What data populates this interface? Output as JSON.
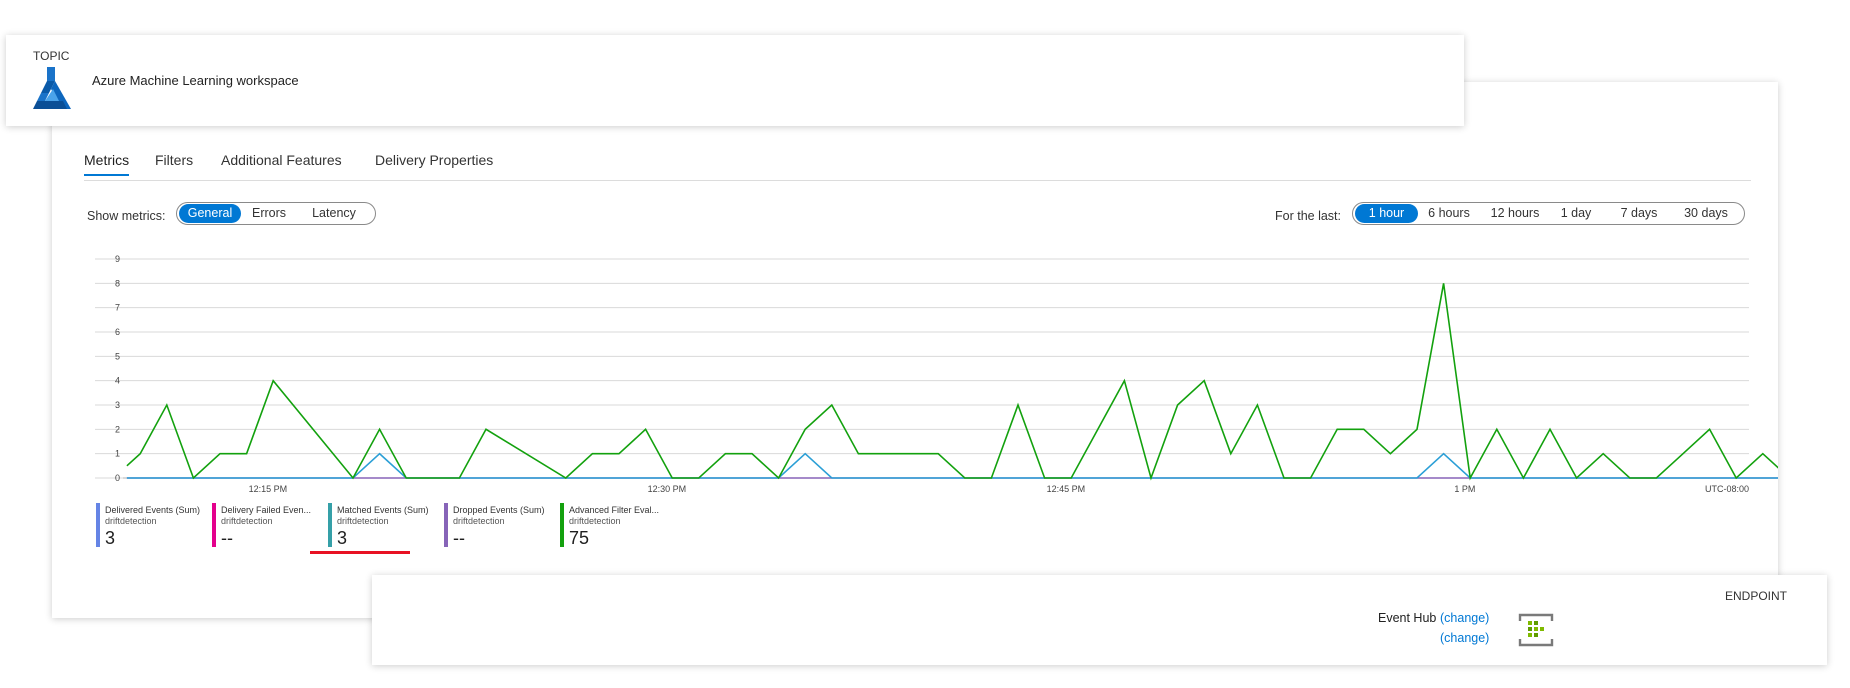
{
  "topic": {
    "caption": "TOPIC",
    "title": "Azure Machine Learning workspace",
    "icon": "azure-ml-flask-icon"
  },
  "tabs": [
    "Metrics",
    "Filters",
    "Additional Features",
    "Delivery Properties"
  ],
  "active_tab": "Metrics",
  "metrics_selector": {
    "label": "Show metrics:",
    "options": [
      "General",
      "Errors",
      "Latency"
    ],
    "selected": "General"
  },
  "time_selector": {
    "label": "For the last:",
    "options": [
      "1 hour",
      "6 hours",
      "12 hours",
      "1 day",
      "7 days",
      "30 days"
    ],
    "selected": "1 hour"
  },
  "colors": {
    "accent": "#0078d4",
    "advanced_filter": "#13a10e",
    "matched": "#2b9fd6",
    "dropped": "#8764b8",
    "delivered": "#6584e5",
    "delivery_failed": "#e3008c",
    "matched_legend": "#35a0a8",
    "highlight": "#e81123"
  },
  "chart_data": {
    "type": "line",
    "x_tick_labels": [
      "12:15 PM",
      "12:30 PM",
      "12:45 PM",
      "1 PM"
    ],
    "timezone_label": "UTC-08:00",
    "y_tick_labels": [
      "0",
      "1",
      "2",
      "3",
      "4",
      "5",
      "6",
      "7",
      "8",
      "9"
    ],
    "ylim": [
      0,
      9
    ],
    "x_range_minutes": [
      0,
      62
    ],
    "grid": true,
    "series": [
      {
        "name": "Advanced Filter Evaluations",
        "color": "#13a10e",
        "points": [
          [
            0,
            0.5
          ],
          [
            0.5,
            1
          ],
          [
            1.5,
            3
          ],
          [
            2.5,
            0
          ],
          [
            3.5,
            1
          ],
          [
            4.5,
            1
          ],
          [
            5.5,
            4
          ],
          [
            8.5,
            0
          ],
          [
            9.5,
            2
          ],
          [
            10.5,
            0
          ],
          [
            12.5,
            0
          ],
          [
            13.5,
            2
          ],
          [
            16.5,
            0
          ],
          [
            17.5,
            1
          ],
          [
            18.5,
            1
          ],
          [
            19.5,
            2
          ],
          [
            20.5,
            0
          ],
          [
            21.5,
            0
          ],
          [
            22.5,
            1
          ],
          [
            23.5,
            1
          ],
          [
            24.5,
            0
          ],
          [
            25.5,
            2
          ],
          [
            26.5,
            3
          ],
          [
            27.5,
            1
          ],
          [
            30.5,
            1
          ],
          [
            31.5,
            0
          ],
          [
            32.5,
            0
          ],
          [
            33.5,
            3
          ],
          [
            34.5,
            0
          ],
          [
            35.5,
            0
          ],
          [
            37.5,
            4
          ],
          [
            38.5,
            0
          ],
          [
            39.5,
            3
          ],
          [
            40.5,
            4
          ],
          [
            41.5,
            1
          ],
          [
            42.5,
            3
          ],
          [
            43.5,
            0
          ],
          [
            44.5,
            0
          ],
          [
            45.5,
            2
          ],
          [
            46.5,
            2
          ],
          [
            47.5,
            1
          ],
          [
            48.5,
            2
          ],
          [
            49.5,
            8
          ],
          [
            50.5,
            0
          ],
          [
            51.5,
            2
          ],
          [
            52.5,
            0
          ],
          [
            53.5,
            2
          ],
          [
            54.5,
            0
          ],
          [
            55.5,
            1
          ],
          [
            56.5,
            0
          ],
          [
            57.5,
            0
          ],
          [
            58.5,
            1
          ],
          [
            59.5,
            2
          ],
          [
            60.5,
            0
          ],
          [
            61.5,
            1
          ],
          [
            62.5,
            0
          ]
        ]
      },
      {
        "name": "Matched Events",
        "color": "#2b9fd6",
        "points": [
          [
            0,
            0
          ],
          [
            8.5,
            0
          ],
          [
            9.5,
            1
          ],
          [
            10.5,
            0
          ],
          [
            24.5,
            0
          ],
          [
            25.5,
            1
          ],
          [
            26.5,
            0
          ],
          [
            48.5,
            0
          ],
          [
            49.5,
            1
          ],
          [
            50.5,
            0
          ],
          [
            62.5,
            0
          ]
        ]
      },
      {
        "name": "Dropped Events",
        "color": "#8764b8",
        "points": [
          [
            0,
            0
          ],
          [
            62.5,
            0
          ]
        ]
      }
    ]
  },
  "legend": [
    {
      "name": "Delivered Events (Sum)",
      "source": "driftdetection",
      "value": "3",
      "color": "#6584e5"
    },
    {
      "name": "Delivery Failed Even...",
      "source": "driftdetection",
      "value": "--",
      "color": "#e3008c"
    },
    {
      "name": "Matched Events (Sum)",
      "source": "driftdetection",
      "value": "3",
      "color": "#35a0a8"
    },
    {
      "name": "Dropped Events (Sum)",
      "source": "driftdetection",
      "value": "--",
      "color": "#8764b8"
    },
    {
      "name": "Advanced Filter Eval...",
      "source": "driftdetection",
      "value": "75",
      "color": "#13a10e"
    }
  ],
  "endpoint": {
    "caption": "ENDPOINT",
    "type": "Event Hub",
    "change_link_1": "(change)",
    "change_link_2": "(change)",
    "icon": "event-hub-icon"
  }
}
